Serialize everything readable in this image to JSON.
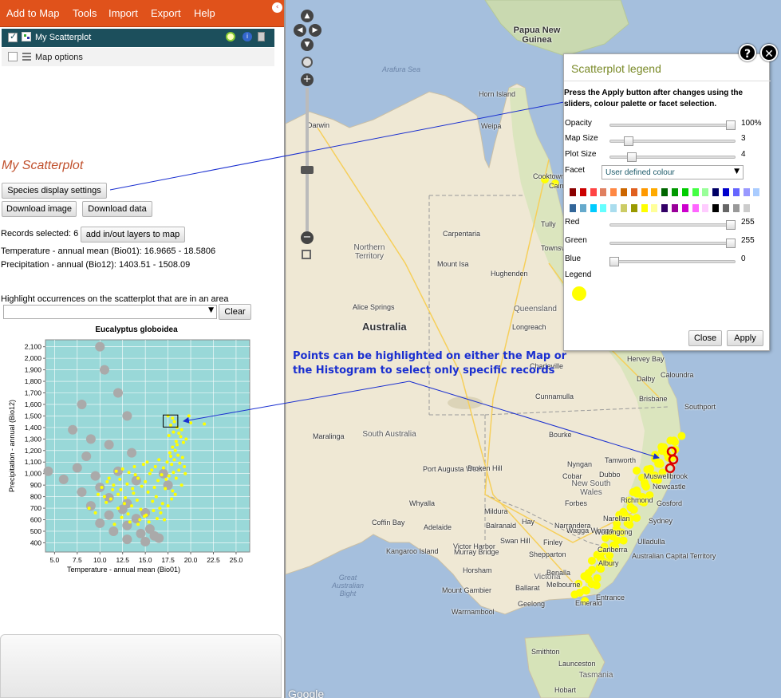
{
  "menu": {
    "items": [
      "Add to Map",
      "Tools",
      "Import",
      "Export",
      "Help"
    ]
  },
  "layers": {
    "scatter_label": "My Scatterplot",
    "map_options_label": "Map options"
  },
  "panel": {
    "title": "My Scatterplot",
    "species_display_button": "Species display settings",
    "download_image_button": "Download image",
    "download_data_button": "Download data",
    "records_selected": "Records selected: 6",
    "add_layers_button": "add in/out layers to map",
    "temperature_range": "Temperature - annual mean (Bio01): 16.9665 - 18.5806",
    "precipitation_range": "Precipitation - annual (Bio12): 1403.51 - 1508.09",
    "highlight_label": "Highlight occurrences on the scatterplot that are in an area",
    "highlight_select_value": "",
    "clear_button": "Clear"
  },
  "chart_data": {
    "type": "scatter",
    "title": "Eucalyptus globoidea",
    "xlabel": "Temperature - annual mean (Bio01)",
    "ylabel": "Precipitation - annual (Bio12)",
    "xlim": [
      4,
      26.5
    ],
    "ylim": [
      320,
      2160
    ],
    "x_ticks": [
      "5.0",
      "7.5",
      "10.0",
      "12.5",
      "15.0",
      "17.5",
      "20.0",
      "22.5",
      "25.0"
    ],
    "y_ticks": [
      "2,100",
      "2,000",
      "1,900",
      "1,800",
      "1,700",
      "1,600",
      "1,500",
      "1,400",
      "1,300",
      "1,200",
      "1,100",
      "1,000",
      "900",
      "800",
      "700",
      "600",
      "500",
      "400"
    ],
    "background": "#99d8d8",
    "highlight_box": {
      "x": [
        16.97,
        18.58
      ],
      "y": [
        1403.51,
        1508.09
      ]
    },
    "series": [
      {
        "color": "#aaaaaa",
        "points": [
          [
            10,
            2100
          ],
          [
            10.5,
            1900
          ],
          [
            12,
            1700
          ],
          [
            8,
            1600
          ],
          [
            13,
            1500
          ],
          [
            7,
            1380
          ],
          [
            9,
            1300
          ],
          [
            11,
            1250
          ],
          [
            13.5,
            1180
          ],
          [
            8.5,
            1150
          ],
          [
            4.3,
            1020
          ],
          [
            7.5,
            1050
          ],
          [
            6,
            950
          ],
          [
            9.5,
            980
          ],
          [
            12,
            1020
          ],
          [
            14,
            940
          ],
          [
            10,
            880
          ],
          [
            8,
            840
          ],
          [
            11,
            790
          ],
          [
            13,
            740
          ],
          [
            9,
            720
          ],
          [
            12.5,
            690
          ],
          [
            15,
            660
          ],
          [
            11,
            640
          ],
          [
            14,
            610
          ],
          [
            10,
            570
          ],
          [
            13,
            550
          ],
          [
            15.5,
            520
          ],
          [
            11.5,
            500
          ],
          [
            14.5,
            480
          ],
          [
            16,
            460
          ],
          [
            13,
            430
          ],
          [
            15,
            410
          ],
          [
            16.5,
            440
          ],
          [
            17.5,
            900
          ],
          [
            17,
            1000
          ]
        ]
      },
      {
        "color": "#ffff00",
        "points": [
          [
            17.5,
            1500
          ],
          [
            18,
            1480
          ],
          [
            18.2,
            1450
          ],
          [
            17.8,
            1420
          ],
          [
            18.5,
            1400
          ],
          [
            19,
            1380
          ],
          [
            18.7,
            1350
          ],
          [
            18.9,
            1320
          ],
          [
            19.5,
            1300
          ],
          [
            19.2,
            1270
          ],
          [
            18.5,
            1250
          ],
          [
            18,
            1230
          ],
          [
            18.3,
            1200
          ],
          [
            17.7,
            1180
          ],
          [
            18.6,
            1160
          ],
          [
            19.1,
            1140
          ],
          [
            18.2,
            1120
          ],
          [
            17.4,
            1100
          ],
          [
            18.8,
            1090
          ],
          [
            17.9,
            1080
          ],
          [
            16.5,
            1120
          ],
          [
            15.2,
            1100
          ],
          [
            14.8,
            1080
          ],
          [
            16.1,
            1060
          ],
          [
            17,
            1050
          ],
          [
            13.8,
            1060
          ],
          [
            12.5,
            1040
          ],
          [
            11.8,
            1020
          ],
          [
            13.2,
            1010
          ],
          [
            15.5,
            1000
          ],
          [
            16.8,
            990
          ],
          [
            17.6,
            980
          ],
          [
            18.4,
            960
          ],
          [
            14.2,
            960
          ],
          [
            12.2,
            950
          ],
          [
            10.8,
            930
          ],
          [
            11.5,
            900
          ],
          [
            13,
            910
          ],
          [
            14.6,
            890
          ],
          [
            16,
            880
          ],
          [
            17.2,
            870
          ],
          [
            18,
            850
          ],
          [
            15.3,
            840
          ],
          [
            13.7,
            830
          ],
          [
            12,
            820
          ],
          [
            10.5,
            800
          ],
          [
            11.2,
            780
          ],
          [
            12.8,
            790
          ],
          [
            14.1,
            770
          ],
          [
            15.8,
            760
          ],
          [
            16.9,
            740
          ],
          [
            17.5,
            720
          ],
          [
            13.5,
            720
          ],
          [
            12,
            700
          ],
          [
            14.5,
            690
          ],
          [
            15.9,
            680
          ],
          [
            16.7,
            660
          ],
          [
            13.1,
            650
          ],
          [
            14.9,
            630
          ],
          [
            16.3,
            610
          ],
          [
            17.1,
            600
          ],
          [
            15.4,
            580
          ],
          [
            14.2,
            560
          ],
          [
            12.7,
            740
          ],
          [
            11.4,
            860
          ],
          [
            10.2,
            880
          ],
          [
            9.8,
            820
          ],
          [
            13.6,
            870
          ],
          [
            15,
            930
          ],
          [
            16.4,
            940
          ],
          [
            17.3,
            950
          ],
          [
            18.1,
            1010
          ],
          [
            18.7,
            1030
          ],
          [
            19.3,
            1060
          ],
          [
            17.8,
            1150
          ],
          [
            18.4,
            1280
          ],
          [
            17.6,
            1330
          ],
          [
            18.1,
            1360
          ],
          [
            20,
            1440
          ],
          [
            21.5,
            1430
          ],
          [
            19.8,
            1500
          ],
          [
            16.2,
            800
          ],
          [
            12.3,
            860
          ],
          [
            11,
            960
          ],
          [
            13.9,
            990
          ],
          [
            15.7,
            1030
          ],
          [
            10.7,
            750
          ],
          [
            12.4,
            620
          ],
          [
            14.4,
            600
          ],
          [
            16.6,
            700
          ],
          [
            17.9,
            780
          ],
          [
            18.3,
            820
          ],
          [
            19,
            900
          ],
          [
            19.4,
            1000
          ],
          [
            9.5,
            660
          ],
          [
            8.8,
            700
          ],
          [
            11.6,
            560
          ],
          [
            13.3,
            580
          ],
          [
            15.1,
            640
          ]
        ]
      }
    ]
  },
  "legend_window": {
    "title": "Scatterplot legend",
    "instructions": "Press the Apply button after changes using the sliders, colour palette or facet selection.",
    "opacity": {
      "label": "Opacity",
      "value": "100%",
      "fraction": 1.0
    },
    "map_size": {
      "label": "Map Size",
      "value": "3",
      "fraction": 0.12
    },
    "plot_size": {
      "label": "Plot Size",
      "value": "4",
      "fraction": 0.15
    },
    "facet": {
      "label": "Facet",
      "value": "User defined colour"
    },
    "red": {
      "label": "Red",
      "value": "255",
      "fraction": 1.0
    },
    "green": {
      "label": "Green",
      "value": "255",
      "fraction": 1.0
    },
    "blue": {
      "label": "Blue",
      "value": "0",
      "fraction": 0.0
    },
    "legend_label": "Legend",
    "legend_color": "#ffff00",
    "palette_row1": [
      "#8b0000",
      "#cc0000",
      "#ff4444",
      "#e08060",
      "#ff8844",
      "#cc6600",
      "#e06020",
      "#ff9900",
      "#ffaa00",
      "#006600",
      "#009900",
      "#00cc00",
      "#44ff44",
      "#99ff99",
      "#000066",
      "#0000cc",
      "#6666ff",
      "#9999ff",
      "#aaccff"
    ],
    "palette_row2": [
      "#336699",
      "#66aacc",
      "#00ccff",
      "#66ffff",
      "#aaddee",
      "#cccc66",
      "#999900",
      "#ffff00",
      "#ffff99",
      "#330066",
      "#990099",
      "#cc00cc",
      "#ff66ff",
      "#ffccff",
      "#000000",
      "#666666",
      "#999999",
      "#cccccc",
      "#ffffff"
    ],
    "close_button": "Close",
    "apply_button": "Apply"
  },
  "annotation": "Points can be highlighted on either the Map or the Histogram to select only specific records",
  "map_labels": [
    {
      "text": "Papua New Guinea",
      "cls": "big"
    },
    {
      "text": "Arafura Sea",
      "cls": "sea"
    },
    {
      "text": "Horn Island"
    },
    {
      "text": "Darwin"
    },
    {
      "text": "Weipa"
    },
    {
      "text": "Cooktown"
    },
    {
      "text": "Cairns"
    },
    {
      "text": "Tully"
    },
    {
      "text": "Townsville"
    },
    {
      "text": "Carpentaria"
    },
    {
      "text": "Northern Territory",
      "cls": "region"
    },
    {
      "text": "Mount Isa"
    },
    {
      "text": "Hughenden"
    },
    {
      "text": "Alice Springs"
    },
    {
      "text": "Australia",
      "cls": "country"
    },
    {
      "text": "Queensland",
      "cls": "region"
    },
    {
      "text": "Longreach"
    },
    {
      "text": "Charleville"
    },
    {
      "text": "Hervey Bay"
    },
    {
      "text": "Dalby"
    },
    {
      "text": "Caloundra"
    },
    {
      "text": "Brisbane"
    },
    {
      "text": "Southport"
    },
    {
      "text": "Cunnamulla"
    },
    {
      "text": "Maralinga"
    },
    {
      "text": "South Australia",
      "cls": "region"
    },
    {
      "text": "Bourke"
    },
    {
      "text": "Tamworth"
    },
    {
      "text": "Port Augusta West"
    },
    {
      "text": "Broken Hill"
    },
    {
      "text": "Nyngan"
    },
    {
      "text": "Cobar"
    },
    {
      "text": "Dubbo"
    },
    {
      "text": "New South Wales",
      "cls": "region"
    },
    {
      "text": "Muswellbrook"
    },
    {
      "text": "Newcastle"
    },
    {
      "text": "Whyalla"
    },
    {
      "text": "Forbes"
    },
    {
      "text": "Richmond"
    },
    {
      "text": "Gosford"
    },
    {
      "text": "Mildura"
    },
    {
      "text": "Coffin Bay"
    },
    {
      "text": "Adelaide"
    },
    {
      "text": "Balranald"
    },
    {
      "text": "Hay"
    },
    {
      "text": "Narrandera"
    },
    {
      "text": "Wagga Wagga"
    },
    {
      "text": "Narellan"
    },
    {
      "text": "Sydney"
    },
    {
      "text": "Wollongong"
    },
    {
      "text": "Kangaroo Island"
    },
    {
      "text": "Victor Harbor"
    },
    {
      "text": "Murray Bridge"
    },
    {
      "text": "Swan Hill"
    },
    {
      "text": "Finley"
    },
    {
      "text": "Canberra"
    },
    {
      "text": "Ulladulla"
    },
    {
      "text": "Shepparton"
    },
    {
      "text": "Albury"
    },
    {
      "text": "Australian Capital Territory"
    },
    {
      "text": "Great Australian Bight",
      "cls": "sea"
    },
    {
      "text": "Horsham"
    },
    {
      "text": "Victoria",
      "cls": "region"
    },
    {
      "text": "Benalla"
    },
    {
      "text": "Mount Gambier"
    },
    {
      "text": "Ballarat"
    },
    {
      "text": "Melbourne"
    },
    {
      "text": "Geelong"
    },
    {
      "text": "Emerald"
    },
    {
      "text": "Entrance"
    },
    {
      "text": "Warrnambool"
    },
    {
      "text": "Smithton"
    },
    {
      "text": "Launceston"
    },
    {
      "text": "Tasmania",
      "cls": "region"
    },
    {
      "text": "Hobart"
    },
    {
      "text": "Google",
      "cls": "google"
    }
  ]
}
